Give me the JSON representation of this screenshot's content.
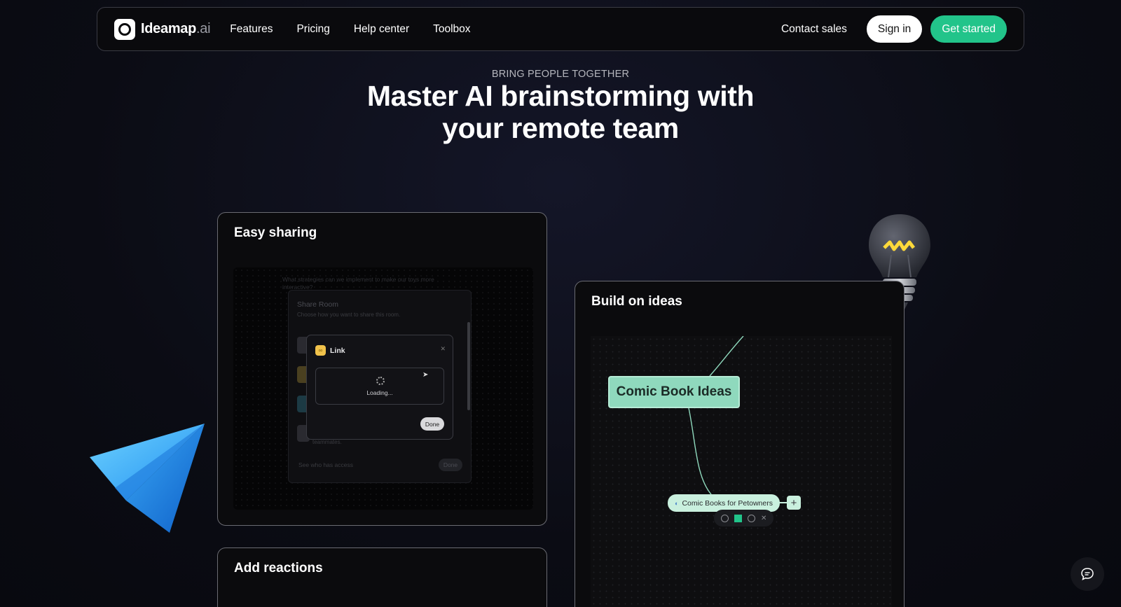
{
  "nav": {
    "brand_name": "Ideamap",
    "brand_suffix": ".ai",
    "links": [
      "Features",
      "Pricing",
      "Help center",
      "Toolbox"
    ],
    "contact": "Contact sales",
    "signin": "Sign in",
    "get_started": "Get started"
  },
  "hero": {
    "eyebrow": "BRING PEOPLE TOGETHER",
    "headline": "Master AI brainstorming with your remote team"
  },
  "cards": {
    "sharing": {
      "title": "Easy sharing",
      "question": "What strategies can we implement to make our toys more interactive?",
      "panel_title": "Share Room",
      "panel_subtitle": "Choose how you want to share this room.",
      "see_access": "See who has access",
      "teammates": "teammates.",
      "dialog_label": "Link",
      "loading": "Loading...",
      "done": "Done"
    },
    "build": {
      "title": "Build on ideas",
      "main_node": "Comic Book Ideas",
      "sub_node": "Comic Books for Petowners"
    },
    "reactions": {
      "title": "Add reactions"
    }
  },
  "colors": {
    "accent": "#22c48a",
    "node_main": "#8fd9bd",
    "node_sub": "#c9f0de"
  },
  "icons": {
    "plane": "paper-plane-icon",
    "bulb": "lightbulb-icon",
    "chat": "chat-bubble-icon"
  }
}
